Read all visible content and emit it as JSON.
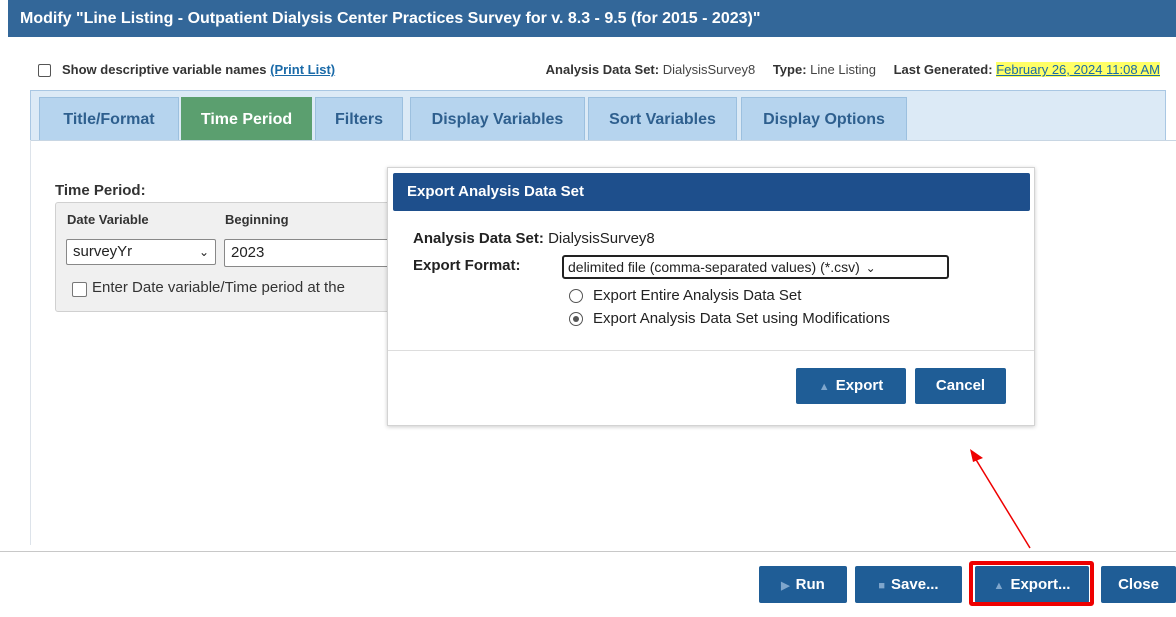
{
  "window": {
    "title": "Modify \"Line Listing - Outpatient Dialysis Center Practices Survey for v. 8.3 - 9.5 (for 2015 - 2023)\""
  },
  "info": {
    "show_descriptive_label": "Show descriptive variable names",
    "print_list_link": "(Print List)",
    "analysis_data_set_label": "Analysis Data Set:",
    "analysis_data_set_value": "DialysisSurvey8",
    "type_label": "Type:",
    "type_value": "Line Listing",
    "last_generated_label": "Last Generated:",
    "last_generated_value": "February 26, 2024 11:08 AM"
  },
  "tabs": [
    {
      "label": "Title/Format",
      "active": false
    },
    {
      "label": "Time Period",
      "active": true
    },
    {
      "label": "Filters",
      "active": false
    },
    {
      "label": "Display Variables",
      "active": false
    },
    {
      "label": "Sort Variables",
      "active": false
    },
    {
      "label": "Display Options",
      "active": false
    }
  ],
  "time_period": {
    "section_title": "Time Period:",
    "date_variable_label": "Date Variable",
    "date_variable_value": "surveyYr",
    "beginning_label": "Beginning",
    "beginning_value": "2023",
    "enter_at_runtime_label": "Enter Date variable/Time period at the"
  },
  "export_modal": {
    "title": "Export Analysis Data Set",
    "data_set_label": "Analysis Data Set:",
    "data_set_value": "DialysisSurvey8",
    "format_label": "Export Format:",
    "format_value": "delimited file (comma-separated values) (*.csv)",
    "options": [
      {
        "label": "Export Entire Analysis Data Set",
        "selected": false
      },
      {
        "label": "Export Analysis Data Set using Modifications",
        "selected": true
      }
    ],
    "export_button": "Export",
    "cancel_button": "Cancel"
  },
  "footer": {
    "run_button": "Run",
    "save_button": "Save...",
    "export_button": "Export...",
    "close_button": "Close"
  },
  "colors": {
    "title_bar": "#336799",
    "active_tab": "#5b9f6f",
    "button": "#1f5d96",
    "modal_header": "#1e4f8c",
    "highlight": "#ee0000"
  }
}
